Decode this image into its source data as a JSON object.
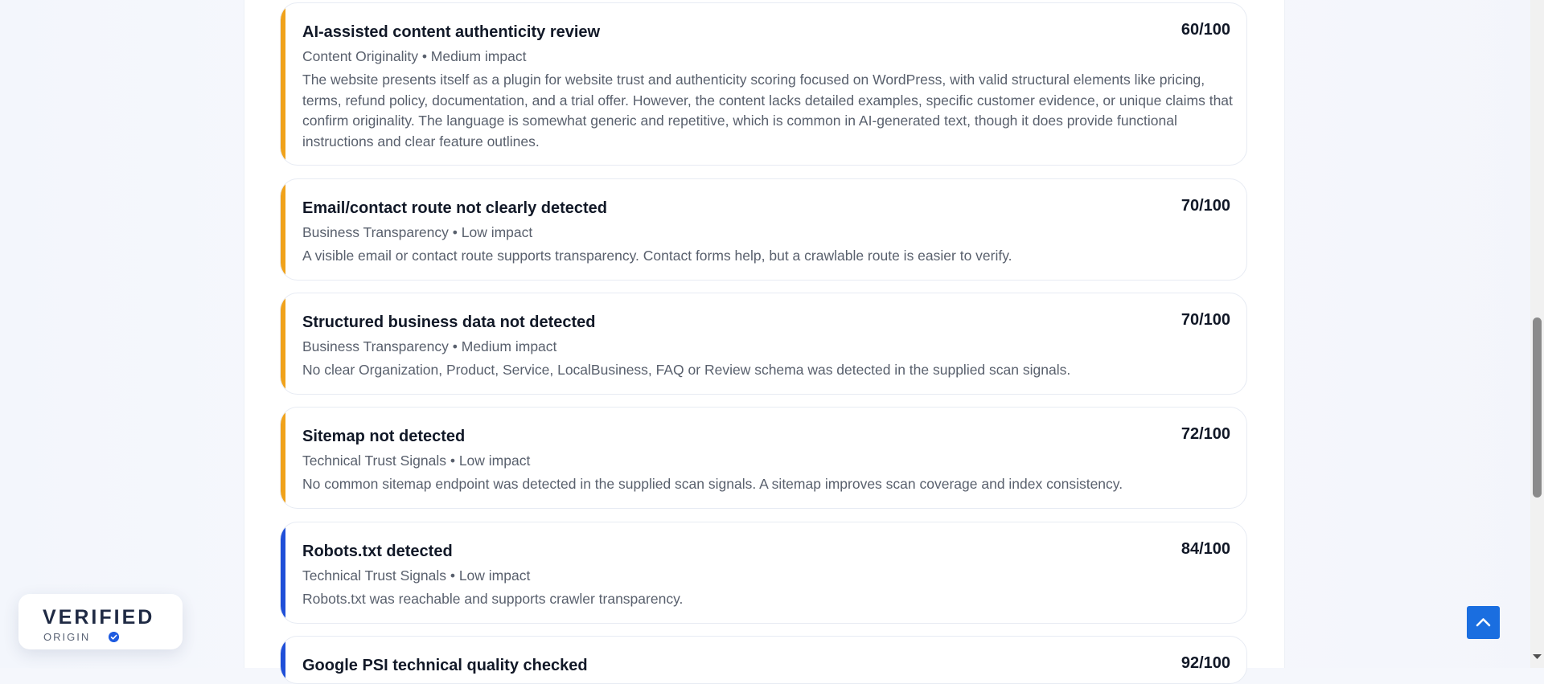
{
  "cards": [
    {
      "title": "AI-assisted content authenticity review",
      "score": "60/100",
      "meta": "Content Originality • Medium impact",
      "description": "The website presents itself as a plugin for website trust and authenticity scoring focused on WordPress, with valid structural elements like pricing, terms, refund policy, documentation, and a trial offer. However, the content lacks detailed examples, specific customer evidence, or unique claims that confirm originality. The language is somewhat generic and repetitive, which is common in AI-generated text, though it does provide functional instructions and clear feature outlines.",
      "accent": "#f0a21b"
    },
    {
      "title": "Email/contact route not clearly detected",
      "score": "70/100",
      "meta": "Business Transparency • Low impact",
      "description": "A visible email or contact route supports transparency. Contact forms help, but a crawlable route is easier to verify.",
      "accent": "#f0a21b"
    },
    {
      "title": "Structured business data not detected",
      "score": "70/100",
      "meta": "Business Transparency • Medium impact",
      "description": "No clear Organization, Product, Service, LocalBusiness, FAQ or Review schema was detected in the supplied scan signals.",
      "accent": "#f0a21b"
    },
    {
      "title": "Sitemap not detected",
      "score": "72/100",
      "meta": "Technical Trust Signals • Low impact",
      "description": "No common sitemap endpoint was detected in the supplied scan signals. A sitemap improves scan coverage and index consistency.",
      "accent": "#f0a21b"
    },
    {
      "title": "Robots.txt detected",
      "score": "84/100",
      "meta": "Technical Trust Signals • Low impact",
      "description": "Robots.txt was reachable and supports crawler transparency.",
      "accent": "#1f4fd8"
    },
    {
      "title": "Google PSI technical quality checked",
      "score": "92/100",
      "meta": "",
      "description": "",
      "accent": "#1f4fd8"
    }
  ],
  "badge": {
    "word": "VERIFIED",
    "sub": "ORIGIN"
  },
  "icons": {
    "to_top": "chevron-up-icon",
    "badge_check": "check-circle-icon",
    "scroll_down": "triangle-down-icon"
  }
}
